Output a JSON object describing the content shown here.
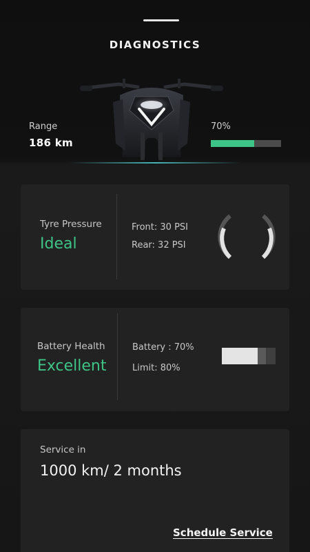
{
  "header": {
    "title": "DIAGNOSTICS"
  },
  "range": {
    "label": "Range",
    "value": "186 km"
  },
  "charge": {
    "percent_label": "70%",
    "level": 0.62
  },
  "tyre": {
    "label": "Tyre Pressure",
    "status": "Ideal",
    "front": "Front: 30 PSI",
    "rear": "Rear: 32 PSI",
    "icon": "tyre-pressure-gauge-icon"
  },
  "battery": {
    "label": "Battery Health",
    "status": "Excellent",
    "battery_text": "Battery : 70%",
    "limit_text": "Limit: 80%",
    "charge_level": 0.7,
    "limit_level": 0.8,
    "icon": "battery-icon"
  },
  "service": {
    "label": "Service in",
    "value": "1000 km/ 2 months",
    "schedule_label": "Schedule Service"
  },
  "colors": {
    "accent": "#3ec486",
    "card": "#222222",
    "background": "#161616"
  }
}
